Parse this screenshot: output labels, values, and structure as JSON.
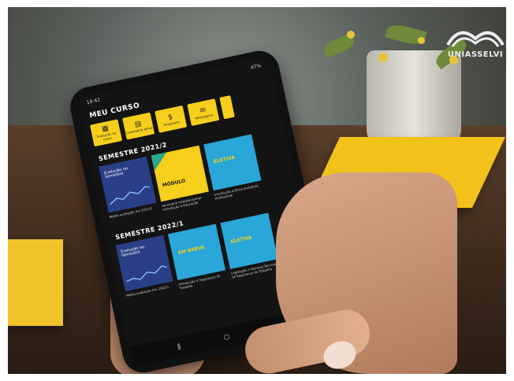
{
  "logo": {
    "text": "UNIASSELVI"
  },
  "phone": {
    "time": "18:42",
    "battery": "47%",
    "title": "MEU CURSO",
    "tiles": [
      {
        "icon": "chart-icon",
        "glyph": "▦",
        "label": "Evolução no curso"
      },
      {
        "icon": "calendar-icon",
        "glyph": "▤",
        "label": "Calendário letivo"
      },
      {
        "icon": "dollar-icon",
        "glyph": "$",
        "label": "Financeiro"
      },
      {
        "icon": "mail-icon",
        "glyph": "✉",
        "label": "Mensagens"
      }
    ],
    "semester1": {
      "title": "SEMESTRE 2021/2",
      "cards": [
        {
          "label": "Evolução no Semestre",
          "caption": "Média avaliação em 2021/2"
        },
        {
          "label": "MÓDULO",
          "caption": "Seminário Interdisciplinar Introdução à Educação"
        },
        {
          "label": "ELETIVA",
          "caption": "Introdução à Ética Ambiente Profissional"
        }
      ]
    },
    "semester2": {
      "title": "SEMESTRE 2022/1",
      "cards": [
        {
          "label": "Evolução no Semestre",
          "caption": "Média avaliação em 2022/1"
        },
        {
          "label": "EM BREVE",
          "caption": "Introdução à Segurança do Trabalho"
        },
        {
          "label": "ELETIVA",
          "caption": "Legislação e Normas Técnicas de Segurança do Trabalho"
        }
      ]
    }
  },
  "colors": {
    "accent": "#f5cf1c",
    "screen_bg": "#141414",
    "card_blue": "#2a3f86",
    "card_cyan": "#2aa6d8"
  }
}
